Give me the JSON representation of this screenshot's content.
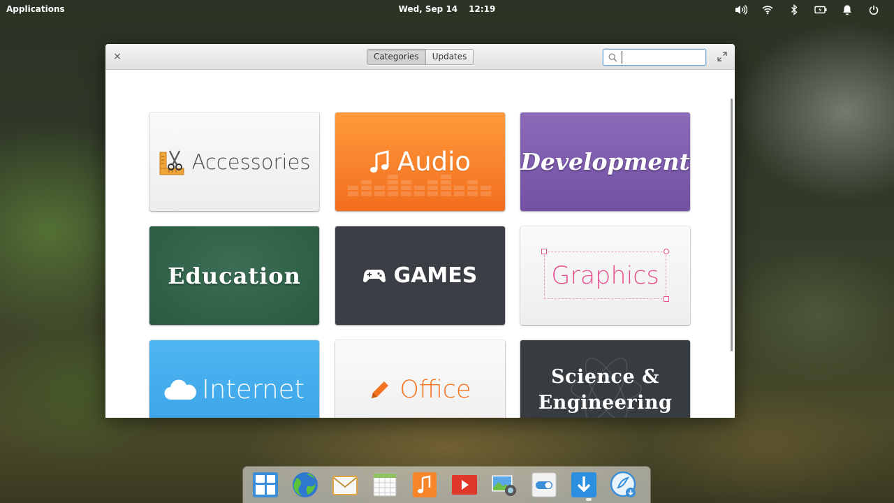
{
  "panel": {
    "applications_label": "Applications",
    "date": "Wed, Sep 14",
    "time": "12:19",
    "indicators": [
      "volume-icon",
      "wifi-icon",
      "bluetooth-icon",
      "battery-icon",
      "notifications-icon",
      "power-icon"
    ]
  },
  "window": {
    "close_label": "×",
    "tabs": [
      {
        "label": "Categories",
        "active": true
      },
      {
        "label": "Updates",
        "active": false
      }
    ],
    "search": {
      "value": "",
      "placeholder": ""
    },
    "categories": [
      {
        "label": "Accessories",
        "color": "#f2f2f2"
      },
      {
        "label": "Audio",
        "color": "#f7842b"
      },
      {
        "label": "Development",
        "color": "#7c5cad"
      },
      {
        "label": "Education",
        "color": "#316349"
      },
      {
        "label": "GAMES",
        "color": "#3b3f45"
      },
      {
        "label": "Graphics",
        "color": "#f2f2f2"
      },
      {
        "label": "Internet",
        "color": "#43abec"
      },
      {
        "label": "Office",
        "color": "#f2f2f2"
      },
      {
        "label": "Science &",
        "label2": "Engineering",
        "color": "#363c40"
      }
    ]
  },
  "dock": {
    "items": [
      "multitasking-view-icon",
      "web-browser-icon",
      "mail-icon",
      "calendar-icon",
      "music-icon",
      "videos-icon",
      "photos-icon",
      "settings-icon",
      "appcenter-icon",
      "updates-icon"
    ]
  }
}
